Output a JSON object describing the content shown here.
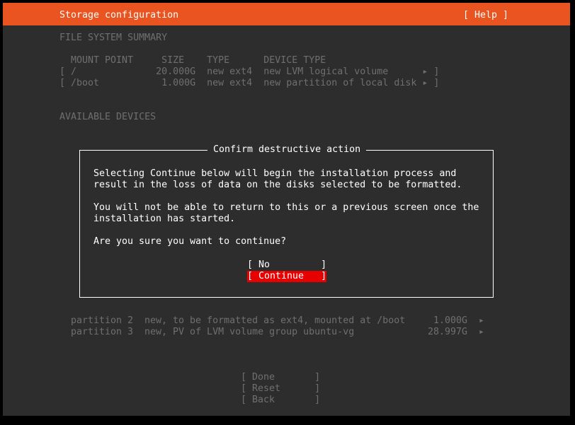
{
  "header": {
    "title": "Storage configuration",
    "help_label": "[ Help ]"
  },
  "summary": {
    "heading": "FILE SYSTEM SUMMARY",
    "columns_line": "  MOUNT POINT     SIZE    TYPE      DEVICE TYPE",
    "rows": [
      {
        "line": "[ /              20.000G  new ext4  new LVM logical volume      ",
        "arrow": "▸ ]"
      },
      {
        "line": "[ /boot           1.000G  new ext4  new partition of local disk ",
        "arrow": "▸ ]"
      }
    ]
  },
  "available": {
    "heading": "AVAILABLE DEVICES",
    "partitions": [
      {
        "name": "partition 2",
        "desc": "new, to be formatted as ext4, mounted at /boot",
        "size": "1.000G",
        "arrow": "▸"
      },
      {
        "name": "partition 3",
        "desc": "new, PV of LVM volume group ubuntu-vg",
        "size": "28.997G",
        "arrow": "▸"
      }
    ]
  },
  "dialog": {
    "title": "Confirm destructive action",
    "para1_line1": "Selecting Continue below will begin the installation process and",
    "para1_line2": "result in the loss of data on the disks selected to be formatted.",
    "para2_line1": "You will not be able to return to this or a previous screen once the",
    "para2_line2": "installation has started.",
    "question": "Are you sure you want to continue?",
    "no_label": "[ No         ]",
    "continue_label": "[ Continue   ]"
  },
  "footer": {
    "done_label": "[ Done       ]",
    "reset_label": "[ Reset      ]",
    "back_label": "[ Back       ]"
  },
  "colors": {
    "accent": "#e95420",
    "background": "#2d2d2d",
    "focus_button": "#e60000",
    "dim_text": "#6f6f6f",
    "text": "#ffffff"
  }
}
